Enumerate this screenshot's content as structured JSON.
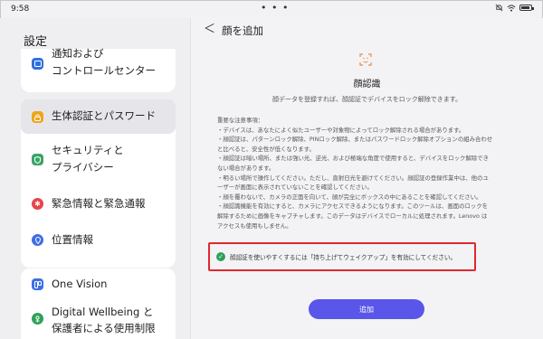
{
  "status_bar": {
    "time": "9:58",
    "center_dots": "• • •",
    "icons": [
      "mute-icon",
      "wifi-icon",
      "battery-icon"
    ]
  },
  "sidebar": {
    "title": "設定",
    "items": [
      {
        "label_line1": "通知および",
        "label_line2": "コントロールセンター",
        "icon": "notification-icon",
        "color": "#2f6fe0"
      },
      {
        "label": "生体認証とパスワード",
        "icon": "lock-icon",
        "color": "#f0a51a",
        "selected": true
      },
      {
        "label_line1": "セキュリティと",
        "label_line2": "プライバシー",
        "icon": "shield-icon",
        "color": "#3aa56a"
      },
      {
        "label": "緊急情報と緊急通報",
        "icon": "asterisk-icon",
        "color": "#e8434b"
      },
      {
        "label": "位置情報",
        "icon": "location-pin-icon",
        "color": "#3d6ee6"
      },
      {
        "label": "One Vision",
        "icon": "one-vision-icon",
        "color": "#3d6ee6"
      },
      {
        "label_line1": "Digital Wellbeing と",
        "label_line2": "保護者による使用制限",
        "icon": "wellbeing-icon",
        "color": "#2fa05b"
      }
    ]
  },
  "header": {
    "back_symbol": "＜",
    "title": "顔を追加"
  },
  "main": {
    "icon": "face-scan-icon",
    "accent_color": "#f08a3c",
    "heading": "顔認識",
    "subtitle": "顔データを登録すれば、顔認証でデバイスをロック解除できます。",
    "notes": [
      "重要な注意事項：",
      "・デバイスは、あなたによく似たユーザーや対象物によってロック解除される場合があります。",
      "・顔認証は、パターンロック解除、PINロック解除、またはパスワードロック解除オプションの組み合わせ",
      "と比べると、安全性が低くなります。",
      "・顔認証は暗い場所、または強い光、逆光、および極端な角度で使用すると、デバイスをロック解除でき",
      "ない場合があります。",
      "・明るい場所で操作してください。ただし、直射日光を避けてください。顔認証の登録作業中は、他のユ",
      "ーザーが画面に表示されていないことを確認してください。",
      "・顔を覆わないで、カメラの正面を向いて、顔が完全にボックスの中にあることを確認してください。",
      "・顔認識機能を有効にすると、カメラにアクセスできるようになります。このツールは、画面のロックを",
      "解除するために画像をキャプチャします。このデータはデバイスでローカルに処理されます。Lenovo は",
      "アクセスも使用もしません。"
    ],
    "hint": "顔認証を使いやすくするには「持ち上げてウェイクアップ」を有効にしてください。",
    "highlight_color": "#e0282e",
    "add_button_label": "追加",
    "button_color": "#5956e9"
  }
}
